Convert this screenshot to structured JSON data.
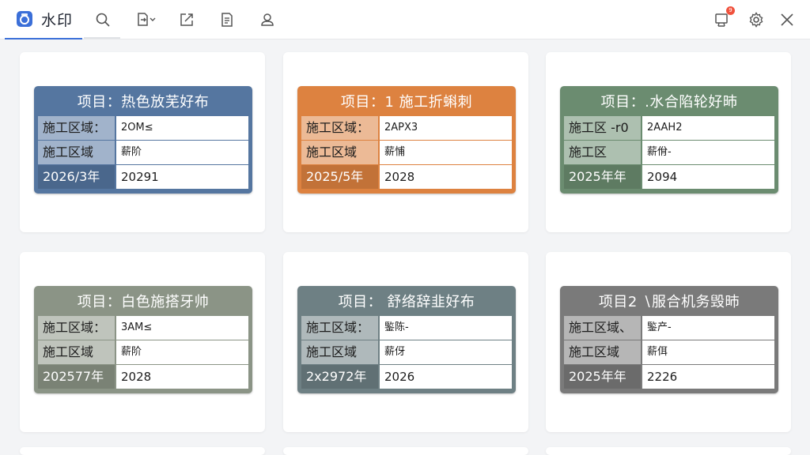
{
  "app": {
    "title": "水印",
    "accent": "#3b6fd8",
    "toolbar_icons": [
      "search-icon",
      "export-dropdown-icon",
      "share-icon",
      "document-icon",
      "user-icon"
    ],
    "right_icons": [
      "notification-icon",
      "settings-icon",
      "close-icon"
    ],
    "notification_badge": "9"
  },
  "cards": [
    {
      "color": "#5576a0",
      "title": "项目：热色放芜好布",
      "rows": [
        {
          "label": "施工区域：",
          "value": "2OM≤"
        },
        {
          "label": "施工区域",
          "value": "薪阶"
        },
        {
          "label": "2026/3年",
          "value": "20291"
        }
      ]
    },
    {
      "color": "#dd8240",
      "title": "项目：1 施工折蝌刺",
      "rows": [
        {
          "label": "施工区域：",
          "value": "2APX3"
        },
        {
          "label": "施工区域",
          "value": "薪悑"
        },
        {
          "label": "2025/5年",
          "value": "2028"
        }
      ]
    },
    {
      "color": "#6b8c70",
      "title": "项目：.水合陷轮好昁",
      "rows": [
        {
          "label": "施工区 -r0",
          "value": "2AAH2"
        },
        {
          "label": "施工区",
          "value": "薪佾-"
        },
        {
          "label": "2025年年",
          "value": "2094"
        }
      ]
    },
    {
      "color": "#8b9486",
      "title": "项目：白色施搭牙帅",
      "rows": [
        {
          "label": "施工区域：",
          "value": "3AM≤"
        },
        {
          "label": "施工区域",
          "value": "薪阶"
        },
        {
          "label": "202577年",
          "value": "2028"
        }
      ]
    },
    {
      "color": "#6e8084",
      "title": "项目：  舒络辞韭好布",
      "rows": [
        {
          "label": "施工区域：",
          "value": "鍳陈-"
        },
        {
          "label": "施工区域",
          "value": "薪伢"
        },
        {
          "label": "2ⅹ2972年",
          "value": "2026"
        }
      ]
    },
    {
      "color": "#7a7a7a",
      "title": "项目2 ∖服合机务毁昁",
      "rows": [
        {
          "label": "施工区域、",
          "value": "鍳产-"
        },
        {
          "label": "施工区域",
          "value": "薪佴"
        },
        {
          "label": "2025年年",
          "value": "2226"
        }
      ]
    }
  ]
}
